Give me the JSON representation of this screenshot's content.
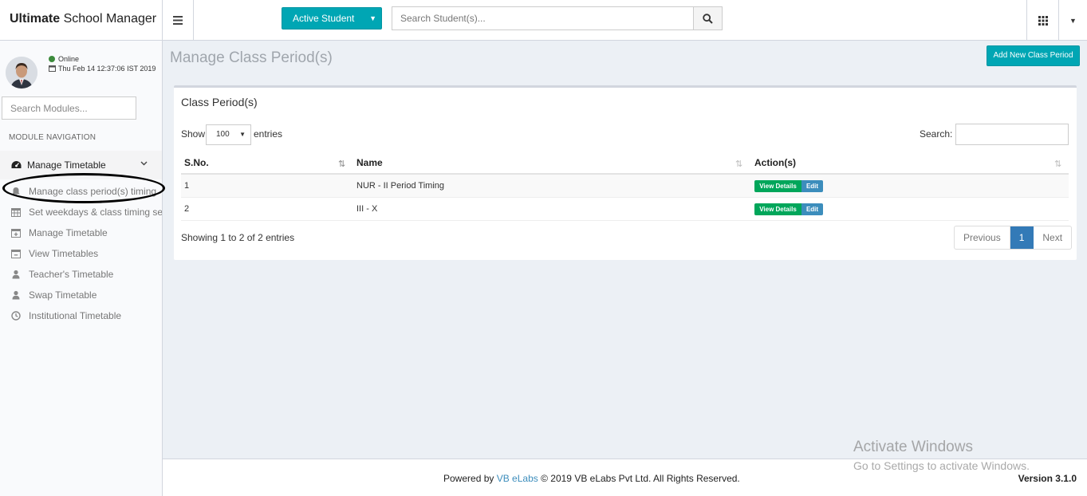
{
  "app": {
    "title_bold": "Ultimate",
    "title_rest": " School Manager"
  },
  "header": {
    "active_student_label": "Active Student",
    "search_placeholder": "Search Student(s)..."
  },
  "sidebar": {
    "status": "Online",
    "datetime": "Thu Feb 14 12:37:06 IST 2019",
    "module_search_placeholder": "Search Modules...",
    "nav_header": "MODULE NAVIGATION",
    "parent_label": "Manage Timetable",
    "items": [
      {
        "label": "Manage class period(s) timing",
        "icon": "bell-icon"
      },
      {
        "label": "Set weekdays & class timing sets",
        "icon": "calendar-icon"
      },
      {
        "label": "Manage Timetable",
        "icon": "calendar-plus-icon"
      },
      {
        "label": "View Timetables",
        "icon": "calendar-minus-icon"
      },
      {
        "label": "Teacher's Timetable",
        "icon": "user-icon"
      },
      {
        "label": "Swap Timetable",
        "icon": "user-icon"
      },
      {
        "label": "Institutional Timetable",
        "icon": "clock-icon"
      }
    ]
  },
  "main": {
    "page_title": "Manage Class Period(s)",
    "add_button": "Add New Class Period",
    "box_title": "Class Period(s)",
    "show_label": "Show",
    "entries_value": "100",
    "entries_label": "entries",
    "search_label": "Search:",
    "columns": [
      "S.No.",
      "Name",
      "Action(s)"
    ],
    "rows": [
      {
        "sno": "1",
        "name": "NUR - II Period Timing"
      },
      {
        "sno": "2",
        "name": "III - X"
      }
    ],
    "view_details_label": "View Details",
    "edit_label": "Edit",
    "info_text": "Showing 1 to 2 of 2 entries",
    "pagination": {
      "previous": "Previous",
      "current": "1",
      "next": "Next"
    }
  },
  "footer": {
    "powered_by": "Powered by",
    "company_link": "VB eLabs",
    "copyright": "© 2019 VB eLabs Pvt Ltd. All Rights Reserved.",
    "version": "Version 3.1.0"
  },
  "watermark": {
    "line1": "Activate Windows",
    "line2": "Go to Settings to activate Windows."
  },
  "colors": {
    "accent": "#00a6b4",
    "view_details": "#00a65a",
    "edit": "#3c8dbc",
    "pagination_active": "#337ab7",
    "online": "#3c8b3c"
  }
}
